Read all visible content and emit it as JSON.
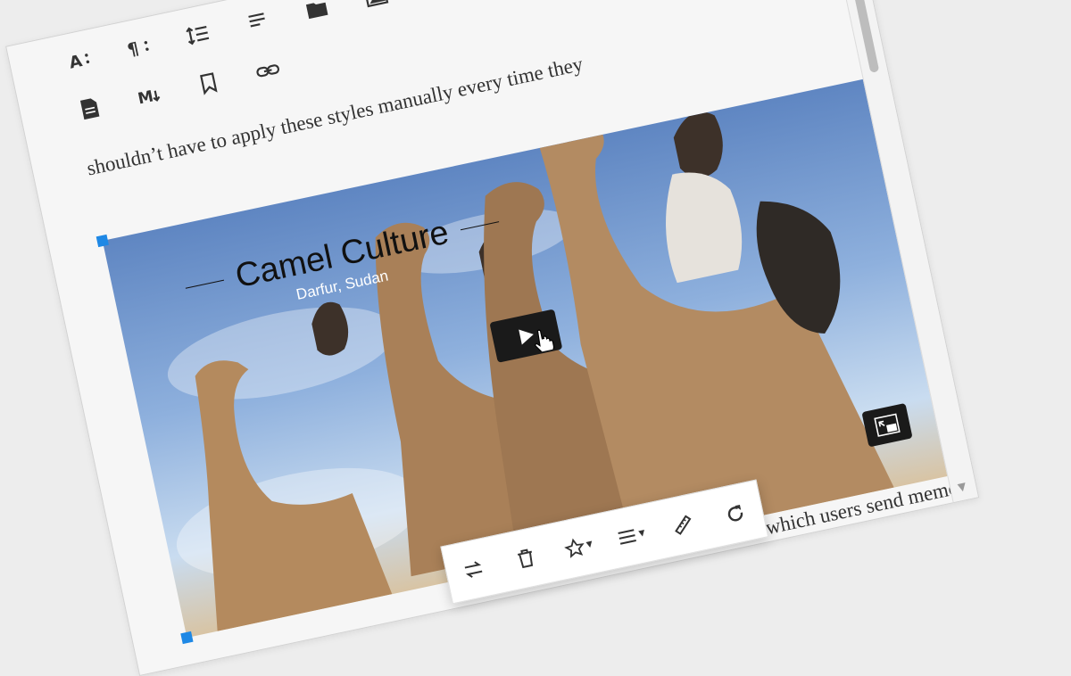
{
  "editor": {
    "text_top_partial": "shouldn’t have to apply these styles manually every time they",
    "text_bottom_partial": "which users send memos"
  },
  "toolbar": {
    "row1": [
      {
        "name": "font-size-icon"
      },
      {
        "name": "paragraph-format-icon"
      },
      {
        "name": "line-height-icon"
      },
      {
        "name": "paragraph-style-icon"
      },
      {
        "name": "folder-icon"
      },
      {
        "name": "insert-image-icon"
      },
      {
        "name": "insert-video-icon"
      }
    ],
    "row2": [
      {
        "name": "document-icon"
      },
      {
        "name": "markdown-icon"
      },
      {
        "name": "bookmark-icon"
      },
      {
        "name": "link-icon"
      }
    ]
  },
  "video": {
    "title": "Camel Culture",
    "subtitle": "Darfur, Sudan"
  },
  "floating_toolbar": [
    {
      "name": "replace-icon"
    },
    {
      "name": "trash-icon"
    },
    {
      "name": "star-icon"
    },
    {
      "name": "align-icon"
    },
    {
      "name": "ruler-icon"
    },
    {
      "name": "redo-icon"
    }
  ],
  "colors": {
    "handle": "#1e88e5",
    "accent_dark": "#1a1a1a"
  }
}
